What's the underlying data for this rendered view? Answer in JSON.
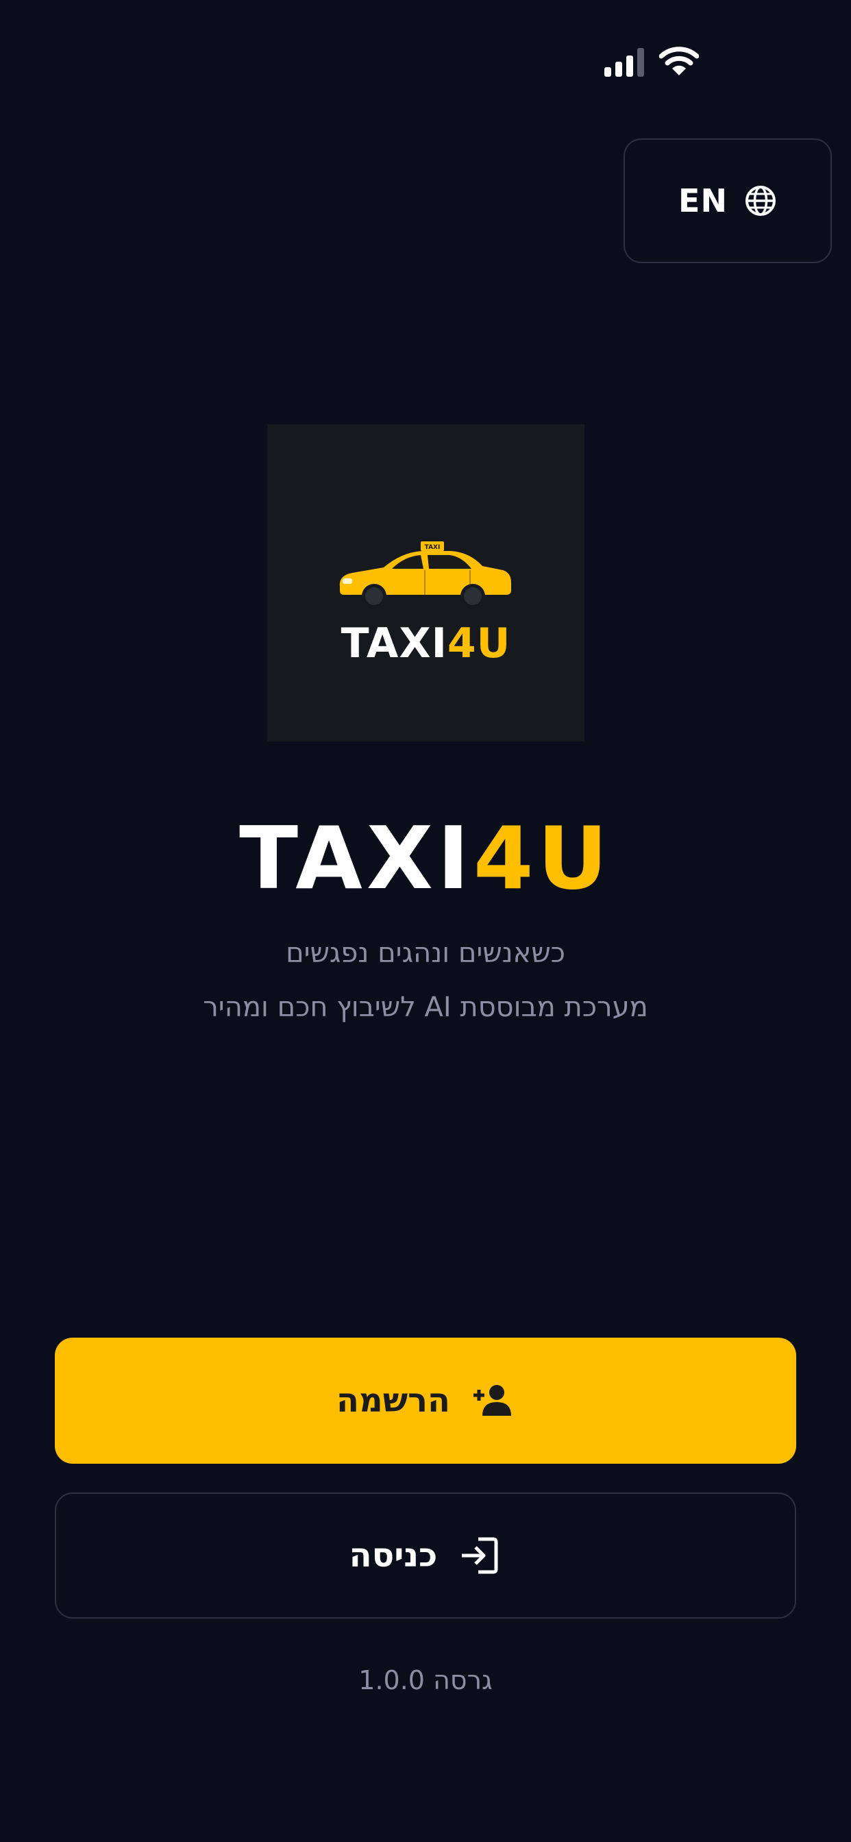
{
  "status_bar": {
    "icons": [
      "signal-icon",
      "wifi-icon"
    ]
  },
  "language_button": {
    "label": "EN",
    "icon": "globe-icon"
  },
  "logo": {
    "text_white": "TAXI",
    "text_yellow": "4U",
    "roof_sign": "TAXI",
    "icon": "taxi-car-icon"
  },
  "brand": {
    "title_white": "TAXI",
    "title_yellow": "4U"
  },
  "tagline": {
    "line1": "כשאנשים ונהגים נפגשים",
    "line2": "מערכת מבוססת AI לשיבוץ חכם ומהיר"
  },
  "actions": {
    "register_label": "הרשמה",
    "register_icon": "person-add-icon",
    "login_label": "כניסה",
    "login_icon": "login-icon"
  },
  "footer": {
    "version": "גרסה 1.0.0"
  },
  "colors": {
    "background": "#0a0d1a",
    "accent": "#ffbf00",
    "muted_text": "#8a8fa3",
    "border": "#2c3142",
    "logo_bg": "#16191d"
  }
}
